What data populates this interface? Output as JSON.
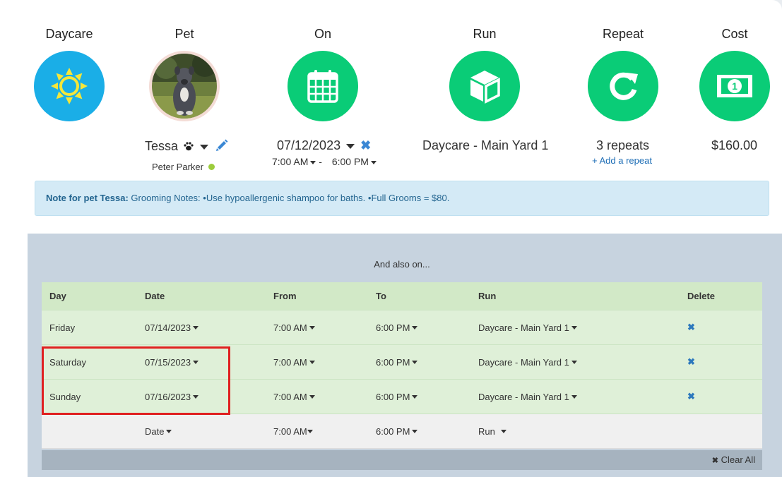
{
  "summary": {
    "daycare": {
      "title": "Daycare"
    },
    "pet": {
      "title": "Pet",
      "name": "Tessa",
      "owner": "Peter Parker"
    },
    "on": {
      "title": "On",
      "date": "07/12/2023",
      "start_time": "7:00 AM",
      "dash": "-",
      "end_time": "6:00 PM"
    },
    "run": {
      "title": "Run",
      "value": "Daycare - Main Yard 1"
    },
    "repeat": {
      "title": "Repeat",
      "value": "3 repeats",
      "add_link": "+ Add a repeat"
    },
    "cost": {
      "title": "Cost",
      "value": "$160.00"
    }
  },
  "note": {
    "label": "Note for pet Tessa:",
    "text": " Grooming Notes: •Use hypoallergenic shampoo for baths. •Full Grooms = $80."
  },
  "repeats": {
    "heading": "And also on...",
    "columns": {
      "day": "Day",
      "date": "Date",
      "from": "From",
      "to": "To",
      "run": "Run",
      "delete": "Delete"
    },
    "rows": [
      {
        "day": "Friday",
        "date": "07/14/2023",
        "from": "7:00 AM",
        "to": "6:00 PM",
        "run": "Daycare - Main Yard 1"
      },
      {
        "day": "Saturday",
        "date": "07/15/2023",
        "from": "7:00 AM",
        "to": "6:00 PM",
        "run": "Daycare - Main Yard 1"
      },
      {
        "day": "Sunday",
        "date": "07/16/2023",
        "from": "7:00 AM",
        "to": "6:00 PM",
        "run": "Daycare - Main Yard 1"
      }
    ],
    "add_row": {
      "date": "Date",
      "from": "7:00 AM",
      "to": "6:00 PM",
      "run": "Run"
    },
    "clear_all": "Clear All"
  },
  "colors": {
    "blue_circle": "#1aaee7",
    "green_circle": "#0acc77",
    "note_bg": "#d4eaf6",
    "row_green": "#dff0d8",
    "highlight": "#e02020"
  }
}
